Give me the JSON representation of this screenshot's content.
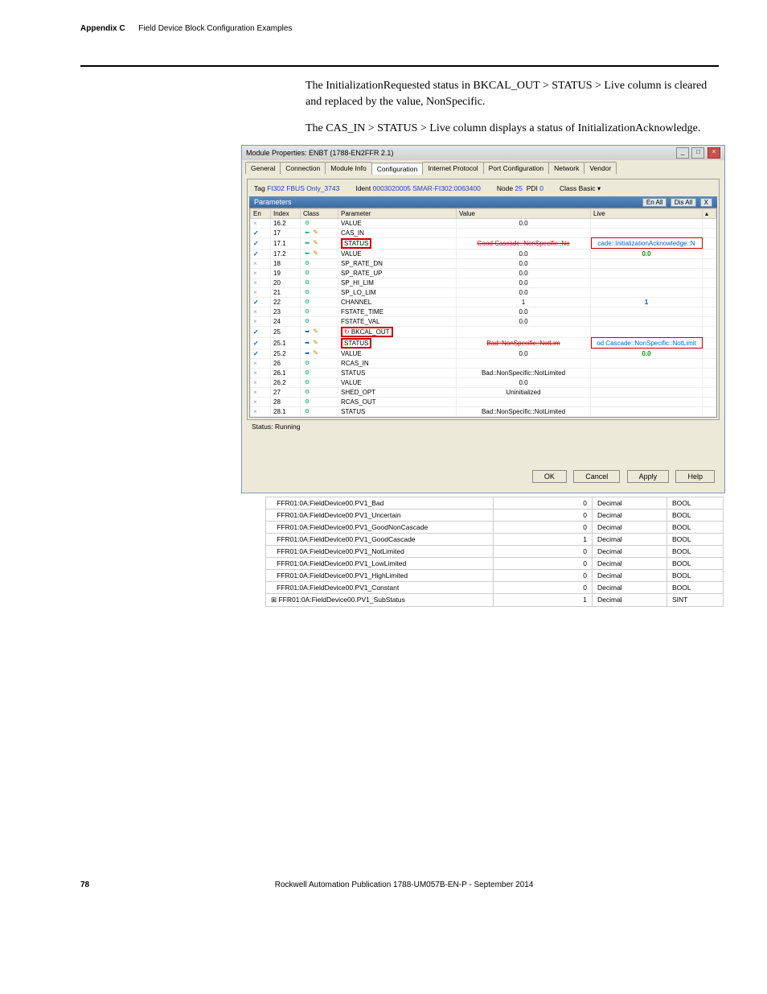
{
  "header": {
    "appendix": "Appendix C",
    "title": "Field Device Block Configuration Examples"
  },
  "body": {
    "p1": "The InitializationRequested status in BKCAL_OUT > STATUS > Live column is cleared and replaced by the value, NonSpecific.",
    "p2": "The CAS_IN > STATUS > Live column displays a status of InitializationAcknowledge."
  },
  "win": {
    "title": "Module Properties: ENBT (1788-EN2FFR 2.1)",
    "tabs": [
      "General",
      "Connection",
      "Module Info",
      "Configuration",
      "Internet Protocol",
      "Port Configuration",
      "Network",
      "Vendor"
    ],
    "active_tab": 3,
    "tag_label": "Tag",
    "tag_value": "FI302 FBUS Only_3743",
    "ident_label": "Ident",
    "ident_value": "0003020005 SMAR-FI302:0063400",
    "node_label": "Node",
    "node_value": "25",
    "pdi_label": "PDI",
    "pdi_value": "0",
    "class_label": "Class",
    "class_value": "Basic",
    "section_title": "Parameters",
    "btn_enall": "En All",
    "btn_disall": "Dis All",
    "btn_x": "X",
    "cols": {
      "en": "En",
      "index": "Index",
      "class": "Class",
      "param": "Parameter",
      "value": "Value",
      "live": "Live"
    },
    "rows": [
      {
        "en": "x",
        "index": "16.2",
        "cls": "cfg",
        "p": "VALUE",
        "v": "0.0",
        "live": ""
      },
      {
        "en": "v",
        "index": "17",
        "cls": "in",
        "p": "CAS_IN",
        "v": "",
        "live": ""
      },
      {
        "en": "v",
        "index": "17.1",
        "cls": "in",
        "p": "STATUS",
        "v": "Good Cascade::NonSpecific::No",
        "live": "cade::InitializationAcknowledge::N",
        "vstrike": true,
        "livebox": true,
        "pbox": true
      },
      {
        "en": "v",
        "index": "17.2",
        "cls": "in",
        "p": "VALUE",
        "v": "0.0",
        "live": "0.0",
        "livegreen": true
      },
      {
        "en": "x",
        "index": "18",
        "cls": "cfg",
        "p": "SP_RATE_DN",
        "v": "0.0",
        "live": ""
      },
      {
        "en": "x",
        "index": "19",
        "cls": "cfg",
        "p": "SP_RATE_UP",
        "v": "0.0",
        "live": ""
      },
      {
        "en": "x",
        "index": "20",
        "cls": "cfg",
        "p": "SP_HI_LIM",
        "v": "0.0",
        "live": ""
      },
      {
        "en": "x",
        "index": "21",
        "cls": "cfg",
        "p": "SP_LO_LIM",
        "v": "0.0",
        "live": ""
      },
      {
        "en": "v",
        "index": "22",
        "cls": "cfg",
        "p": "CHANNEL",
        "v": "1",
        "live": "1",
        "liveblue": true
      },
      {
        "en": "x",
        "index": "23",
        "cls": "cfg",
        "p": "FSTATE_TIME",
        "v": "0.0",
        "live": ""
      },
      {
        "en": "x",
        "index": "24",
        "cls": "cfg",
        "p": "FSTATE_VAL",
        "v": "0.0",
        "live": ""
      },
      {
        "en": "v",
        "index": "25",
        "cls": "out",
        "p": "BKCAL_OUT",
        "v": "",
        "live": "",
        "pbox": true,
        "refresh": true
      },
      {
        "en": "v",
        "index": "25.1",
        "cls": "out",
        "p": "STATUS",
        "v": "Bad::NonSpecific::NotLim",
        "live": "od Cascade::NonSpecific::NotLimit",
        "vstrike": true,
        "livebox": true,
        "pbox": true
      },
      {
        "en": "v",
        "index": "25.2",
        "cls": "out",
        "p": "VALUE",
        "v": "0.0",
        "live": "0.0",
        "livegreen": true
      },
      {
        "en": "x",
        "index": "26",
        "cls": "cfg",
        "p": "RCAS_IN",
        "v": "",
        "live": ""
      },
      {
        "en": "x",
        "index": "26.1",
        "cls": "cfg",
        "p": "STATUS",
        "v": "Bad::NonSpecific::NotLimited",
        "live": ""
      },
      {
        "en": "x",
        "index": "26.2",
        "cls": "cfg",
        "p": "VALUE",
        "v": "0.0",
        "live": ""
      },
      {
        "en": "x",
        "index": "27",
        "cls": "cfg",
        "p": "SHED_OPT",
        "v": "Uninitialized",
        "live": ""
      },
      {
        "en": "x",
        "index": "28",
        "cls": "cfg",
        "p": "RCAS_OUT",
        "v": "",
        "live": ""
      },
      {
        "en": "x",
        "index": "28.1",
        "cls": "cfg",
        "p": "STATUS",
        "v": "Bad::NonSpecific::NotLimited",
        "live": ""
      }
    ],
    "status_label": "Status:",
    "status_value": "Running",
    "btn_ok": "OK",
    "btn_cancel": "Cancel",
    "btn_apply": "Apply",
    "btn_help": "Help"
  },
  "lower": [
    {
      "name": "FFR01:0A:FieldDevice00.PV1_Bad",
      "v": "0",
      "fmt": "Decimal",
      "type": "BOOL"
    },
    {
      "name": "FFR01:0A:FieldDevice00.PV1_Uncertain",
      "v": "0",
      "fmt": "Decimal",
      "type": "BOOL"
    },
    {
      "name": "FFR01:0A:FieldDevice00.PV1_GoodNonCascade",
      "v": "0",
      "fmt": "Decimal",
      "type": "BOOL"
    },
    {
      "name": "FFR01:0A:FieldDevice00.PV1_GoodCascade",
      "v": "1",
      "fmt": "Decimal",
      "type": "BOOL"
    },
    {
      "name": "FFR01:0A:FieldDevice00.PV1_NotLimited",
      "v": "0",
      "fmt": "Decimal",
      "type": "BOOL"
    },
    {
      "name": "FFR01:0A:FieldDevice00.PV1_LowLimited",
      "v": "0",
      "fmt": "Decimal",
      "type": "BOOL"
    },
    {
      "name": "FFR01:0A:FieldDevice00.PV1_HighLimited",
      "v": "0",
      "fmt": "Decimal",
      "type": "BOOL"
    },
    {
      "name": "FFR01:0A:FieldDevice00.PV1_Constant",
      "v": "0",
      "fmt": "Decimal",
      "type": "BOOL"
    },
    {
      "name": "FFR01:0A:FieldDevice00.PV1_SubStatus",
      "v": "1",
      "fmt": "Decimal",
      "type": "SINT",
      "expand": true
    }
  ],
  "footer": {
    "page": "78",
    "pub": "Rockwell Automation Publication 1788-UM057B-EN-P - September 2014"
  }
}
